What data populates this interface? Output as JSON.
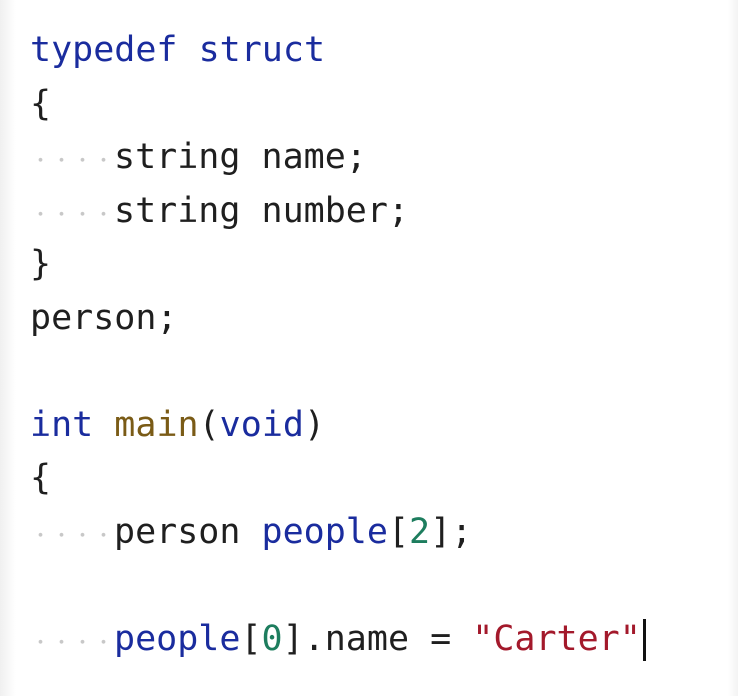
{
  "colors": {
    "keyword": "#1a2c9e",
    "function": "#7a5b16",
    "number": "#1d7d5e",
    "string": "#a3192b",
    "text": "#1f1f1f",
    "whitespace_dot": "#c8c8c8",
    "background": "#ffffff"
  },
  "editor": {
    "icons": {
      "indent_marker": "whitespace-dots",
      "cursor": "text-caret"
    },
    "lines": [
      [
        {
          "t": "typedef",
          "c": "keyword"
        },
        {
          "t": " "
        },
        {
          "t": "struct",
          "c": "keyword"
        }
      ],
      [
        {
          "t": "{"
        }
      ],
      [
        {
          "ws": 4
        },
        {
          "t": "string name;"
        }
      ],
      [
        {
          "ws": 4
        },
        {
          "t": "string number;"
        }
      ],
      [
        {
          "t": "}"
        }
      ],
      [
        {
          "t": "person;"
        }
      ],
      [],
      [
        {
          "t": "int",
          "c": "keyword"
        },
        {
          "t": " "
        },
        {
          "t": "main",
          "c": "function"
        },
        {
          "t": "("
        },
        {
          "t": "void",
          "c": "keyword"
        },
        {
          "t": ")"
        }
      ],
      [
        {
          "t": "{"
        }
      ],
      [
        {
          "ws": 4
        },
        {
          "t": "person "
        },
        {
          "t": "people",
          "c": "keyword"
        },
        {
          "t": "["
        },
        {
          "t": "2",
          "c": "number"
        },
        {
          "t": "];"
        }
      ],
      [],
      [
        {
          "ws": 4
        },
        {
          "t": "people",
          "c": "keyword"
        },
        {
          "t": "["
        },
        {
          "t": "0",
          "c": "number"
        },
        {
          "t": "].name = "
        },
        {
          "t": "\"Carter\"",
          "c": "string"
        },
        {
          "caret": true
        }
      ]
    ]
  }
}
